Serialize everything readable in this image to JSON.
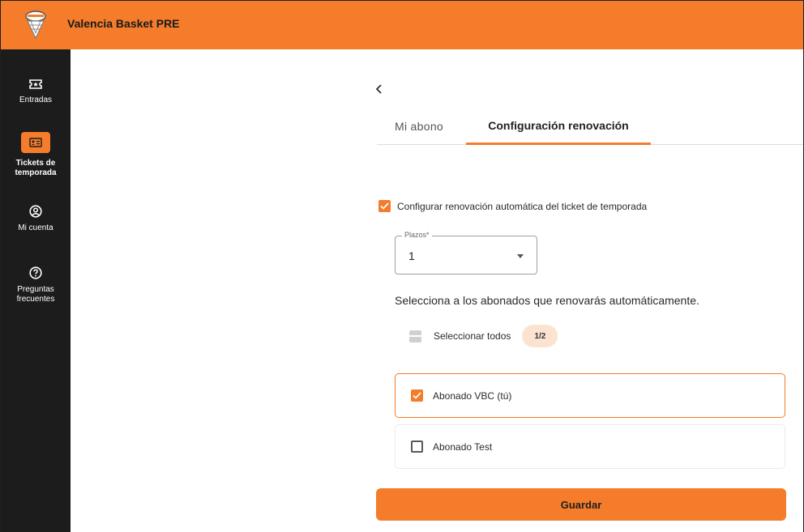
{
  "app": {
    "title": "Valencia Basket PRE"
  },
  "colors": {
    "accent": "#f47c2b",
    "sidebar": "#1c1c1c",
    "badge_bg": "#fbe3d1"
  },
  "sidebar": {
    "items": [
      {
        "label": "Entradas",
        "icon": "ticket-icon",
        "active": false
      },
      {
        "label_line1": "Tickets de",
        "label_line2": "temporada",
        "icon": "id-card-icon",
        "active": true
      },
      {
        "label": "Mi cuenta",
        "icon": "account-circle-icon",
        "active": false
      },
      {
        "label_line1": "Preguntas",
        "label_line2": "frecuentes",
        "icon": "help-circle-icon",
        "active": false
      }
    ]
  },
  "main": {
    "tabs": [
      {
        "label": "Mi abono",
        "active": false
      },
      {
        "label": "Configuración renovación",
        "active": true
      }
    ],
    "auto_renewal": {
      "label": "Configurar renovación automática del ticket de temporada",
      "checked": true
    },
    "plazos": {
      "label": "Plazos*",
      "value": "1"
    },
    "instruction": "Selecciona a los abonados que renovarás automáticamente.",
    "select_all": {
      "label": "Seleccionar todos",
      "count": "1/2",
      "state": "indeterminate"
    },
    "subscribers": [
      {
        "label": "Abonado VBC (tú)",
        "checked": true
      },
      {
        "label": "Abonado Test",
        "checked": false
      }
    ],
    "save_label": "Guardar"
  }
}
